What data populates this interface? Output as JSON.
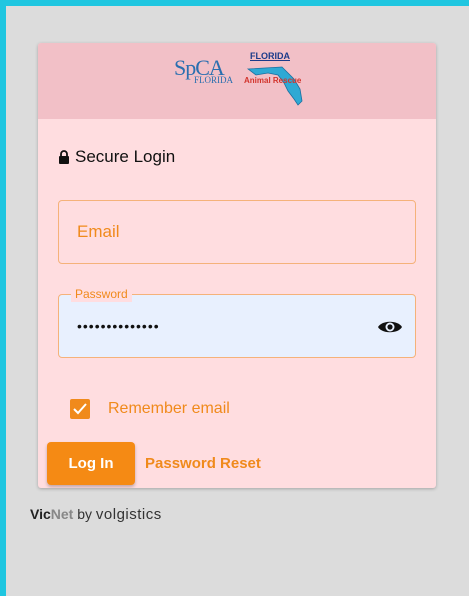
{
  "header": {
    "logo_spca_top": "SpCA",
    "logo_spca_bottom": "FLORIDA",
    "logo_far_top": "FLORIDA",
    "logo_far_bottom": "Animal Rescue"
  },
  "login": {
    "title": "Secure Login",
    "email_placeholder": "Email",
    "password_label": "Password",
    "password_value": "••••••••••••••",
    "remember_label": "Remember email",
    "remember_checked": true,
    "login_button": "Log In",
    "reset_link": "Password Reset"
  },
  "footer": {
    "vic": "Vic",
    "net": "Net",
    "by": " by ",
    "brand": "volgistics"
  },
  "colors": {
    "accent": "#f58a14",
    "card_bg": "#ffdde0",
    "header_bg": "#f2c0c7",
    "page_bg": "#dcdcdc",
    "border": "#1fc6e0"
  },
  "icons": {
    "lock": "lock-icon",
    "eye": "eye-icon",
    "check": "check-icon"
  }
}
